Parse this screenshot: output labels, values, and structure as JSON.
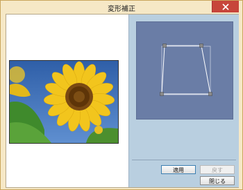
{
  "window": {
    "title": "変形補正"
  },
  "buttons": {
    "apply_label": "適用",
    "undo_label": "戻す",
    "close_label": "閉じる"
  },
  "icons": {
    "close": "close-icon"
  },
  "colors": {
    "titlebar": "#f6e8c6",
    "close_button": "#c7453a",
    "panel": "#b9cfe0",
    "preview_bg": "#6a7da6",
    "handle": "#808080"
  }
}
